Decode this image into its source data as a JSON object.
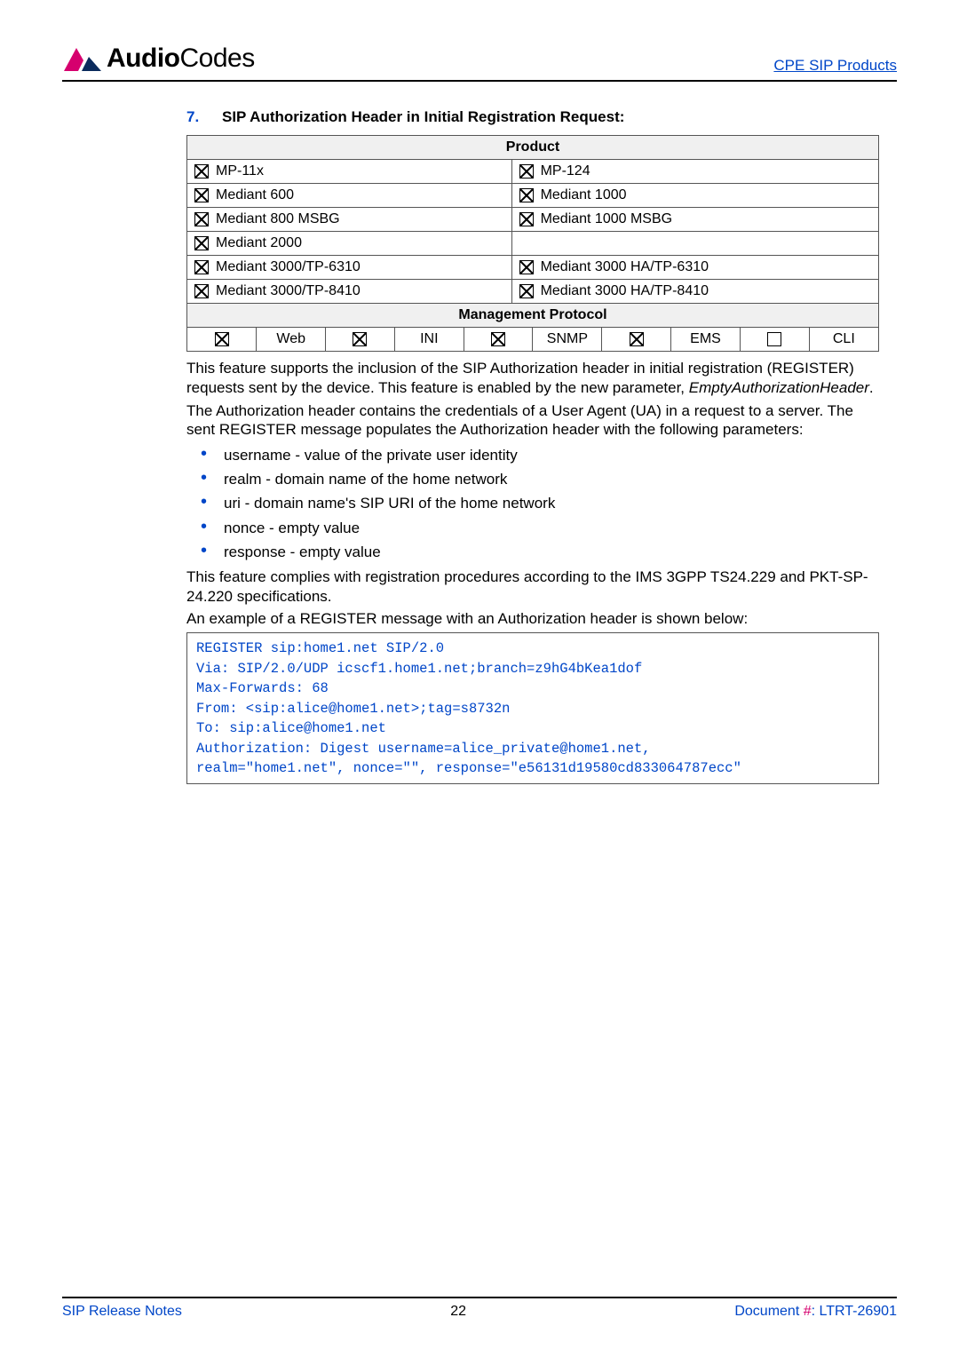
{
  "header": {
    "brand_bold": "Audio",
    "brand_rest": "Codes",
    "right_link": "CPE SIP Products"
  },
  "section": {
    "number": "7.",
    "title": "SIP Authorization Header in Initial Registration Request:"
  },
  "product_table": {
    "header": "Product",
    "rows": [
      {
        "left_checked": true,
        "left_label": "MP-11x",
        "right_checked": true,
        "right_label": "MP-124"
      },
      {
        "left_checked": true,
        "left_label": "Mediant 600",
        "right_checked": true,
        "right_label": "Mediant 1000"
      },
      {
        "left_checked": true,
        "left_label": "Mediant 800 MSBG",
        "right_checked": true,
        "right_label": "Mediant 1000 MSBG"
      },
      {
        "left_checked": true,
        "left_label": "Mediant 2000",
        "right_checked": false,
        "right_label": ""
      },
      {
        "left_checked": true,
        "left_label": "Mediant 3000/TP-6310",
        "right_checked": true,
        "right_label": "Mediant 3000 HA/TP-6310"
      },
      {
        "left_checked": true,
        "left_label": "Mediant 3000/TP-8410",
        "right_checked": true,
        "right_label": "Mediant 3000 HA/TP-8410"
      }
    ],
    "mgmt_header": "Management Protocol",
    "mgmt": [
      {
        "checked": true,
        "label": "Web"
      },
      {
        "checked": true,
        "label": "INI"
      },
      {
        "checked": true,
        "label": "SNMP"
      },
      {
        "checked": true,
        "label": "EMS"
      },
      {
        "checked": false,
        "label": "CLI"
      }
    ]
  },
  "desc": {
    "p1": "This feature supports the inclusion of the SIP Authorization header in initial registration (REGISTER) requests sent by the device. This feature is enabled by the new parameter, ",
    "p1_em": "EmptyAuthorizationHeader",
    "p1_tail": ".",
    "p2": "The Authorization header contains the credentials of a User Agent (UA) in a request to a server. The sent REGISTER message populates the Authorization header with the following parameters:",
    "bullets": [
      "username - value of the private user identity",
      "realm - domain name of the home network",
      "uri - domain name's SIP URI of the home network",
      "nonce - empty value",
      "response - empty value"
    ],
    "p3": "This feature complies with registration procedures according to the IMS 3GPP TS24.229 and PKT-SP-24.220 specifications.",
    "p4": "An example of a REGISTER message with an Authorization header is shown below:"
  },
  "code": "REGISTER sip:home1.net SIP/2.0\nVia: SIP/2.0/UDP icscf1.home1.net;branch=z9hG4bKea1dof\nMax-Forwards: 68\nFrom: <sip:alice@home1.net>;tag=s8732n\nTo: sip:alice@home1.net\nAuthorization: Digest username=alice_private@home1.net,\nrealm=\"home1.net\", nonce=\"\", response=\"e56131d19580cd833064787ecc\"",
  "footer": {
    "left": "SIP Release Notes",
    "center": "22",
    "right_label": "Document ",
    "right_hash": "#",
    "right_tail": ": LTRT-26901"
  }
}
